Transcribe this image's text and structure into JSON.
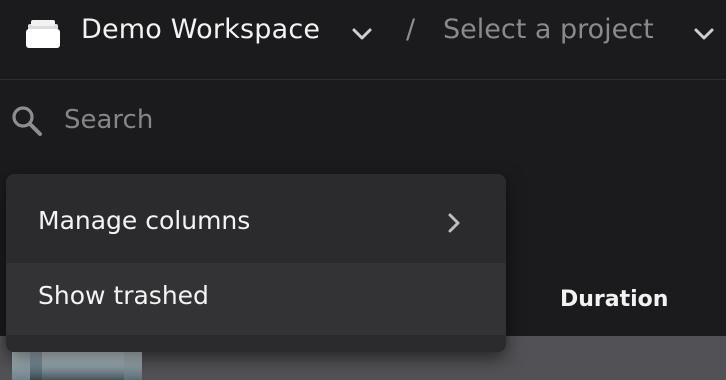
{
  "header": {
    "workspace_name": "Demo Workspace",
    "separator": "/",
    "project_placeholder": "Select a project"
  },
  "search": {
    "placeholder": "Search"
  },
  "table": {
    "columns": {
      "duration": "Duration"
    }
  },
  "context_menu": {
    "items": [
      {
        "label": "Manage columns",
        "has_submenu": true
      },
      {
        "label": "Show trashed",
        "has_submenu": false
      }
    ]
  },
  "icons": {
    "workspace": "folder-stack-icon",
    "workspace_dropdown": "chevron-down-icon",
    "project_dropdown": "chevron-down-icon",
    "search": "search-icon",
    "submenu": "chevron-right-icon"
  },
  "colors": {
    "background": "#1b1b1d",
    "menu_background": "#2b2b2e",
    "menu_hover": "#333336",
    "placeholder_text": "#85858a"
  }
}
